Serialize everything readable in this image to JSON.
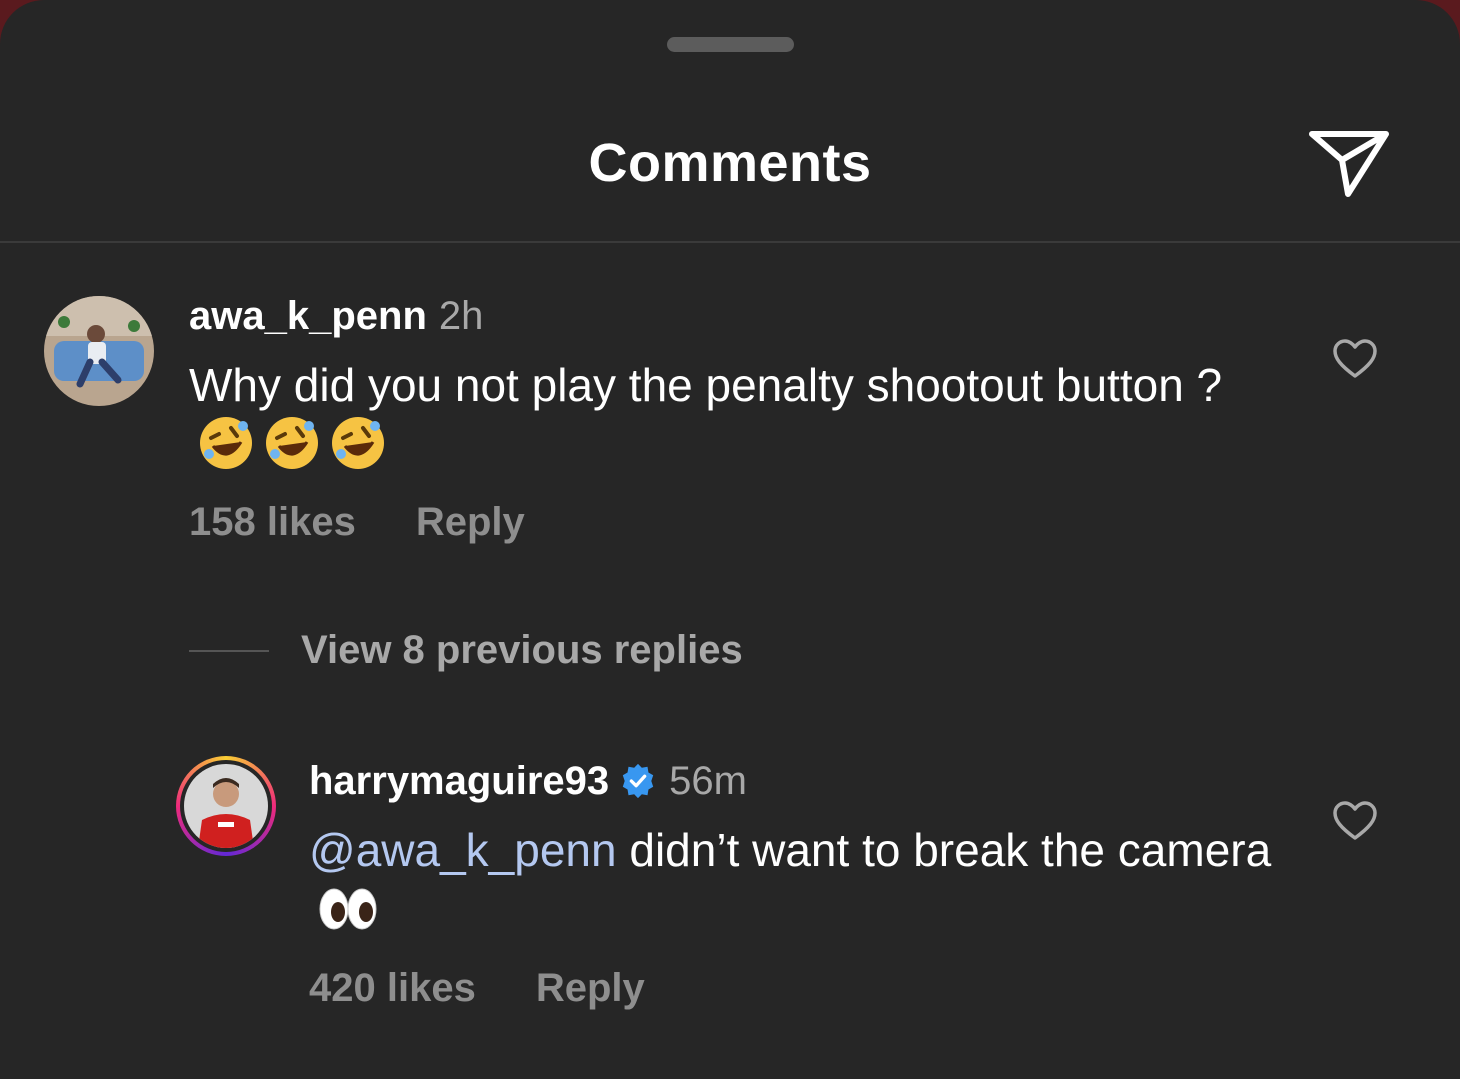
{
  "header": {
    "title": "Comments",
    "share_icon": "paper-plane-icon"
  },
  "comments": [
    {
      "username": "awa_k_penn",
      "time": "2h",
      "text": "Why did you not play the penalty shootout button ?",
      "emojis": [
        "rolling-on-floor-laughing",
        "rolling-on-floor-laughing",
        "rolling-on-floor-laughing"
      ],
      "likes": "158 likes",
      "reply": "Reply",
      "liked": false
    },
    {
      "username": "harrymaguire93",
      "verified": true,
      "time": "56m",
      "mention": "@awa_k_penn",
      "text": " didn’t want to break the camera",
      "emojis": [
        "eyes"
      ],
      "likes": "420 likes",
      "reply": "Reply",
      "liked": false
    }
  ],
  "view_replies": "View 8 previous replies",
  "colors": {
    "background": "#262626",
    "text": "#ffffff",
    "muted": "#8e8e8e",
    "mention": "#b4c8f0",
    "verified": "#3897f0"
  }
}
